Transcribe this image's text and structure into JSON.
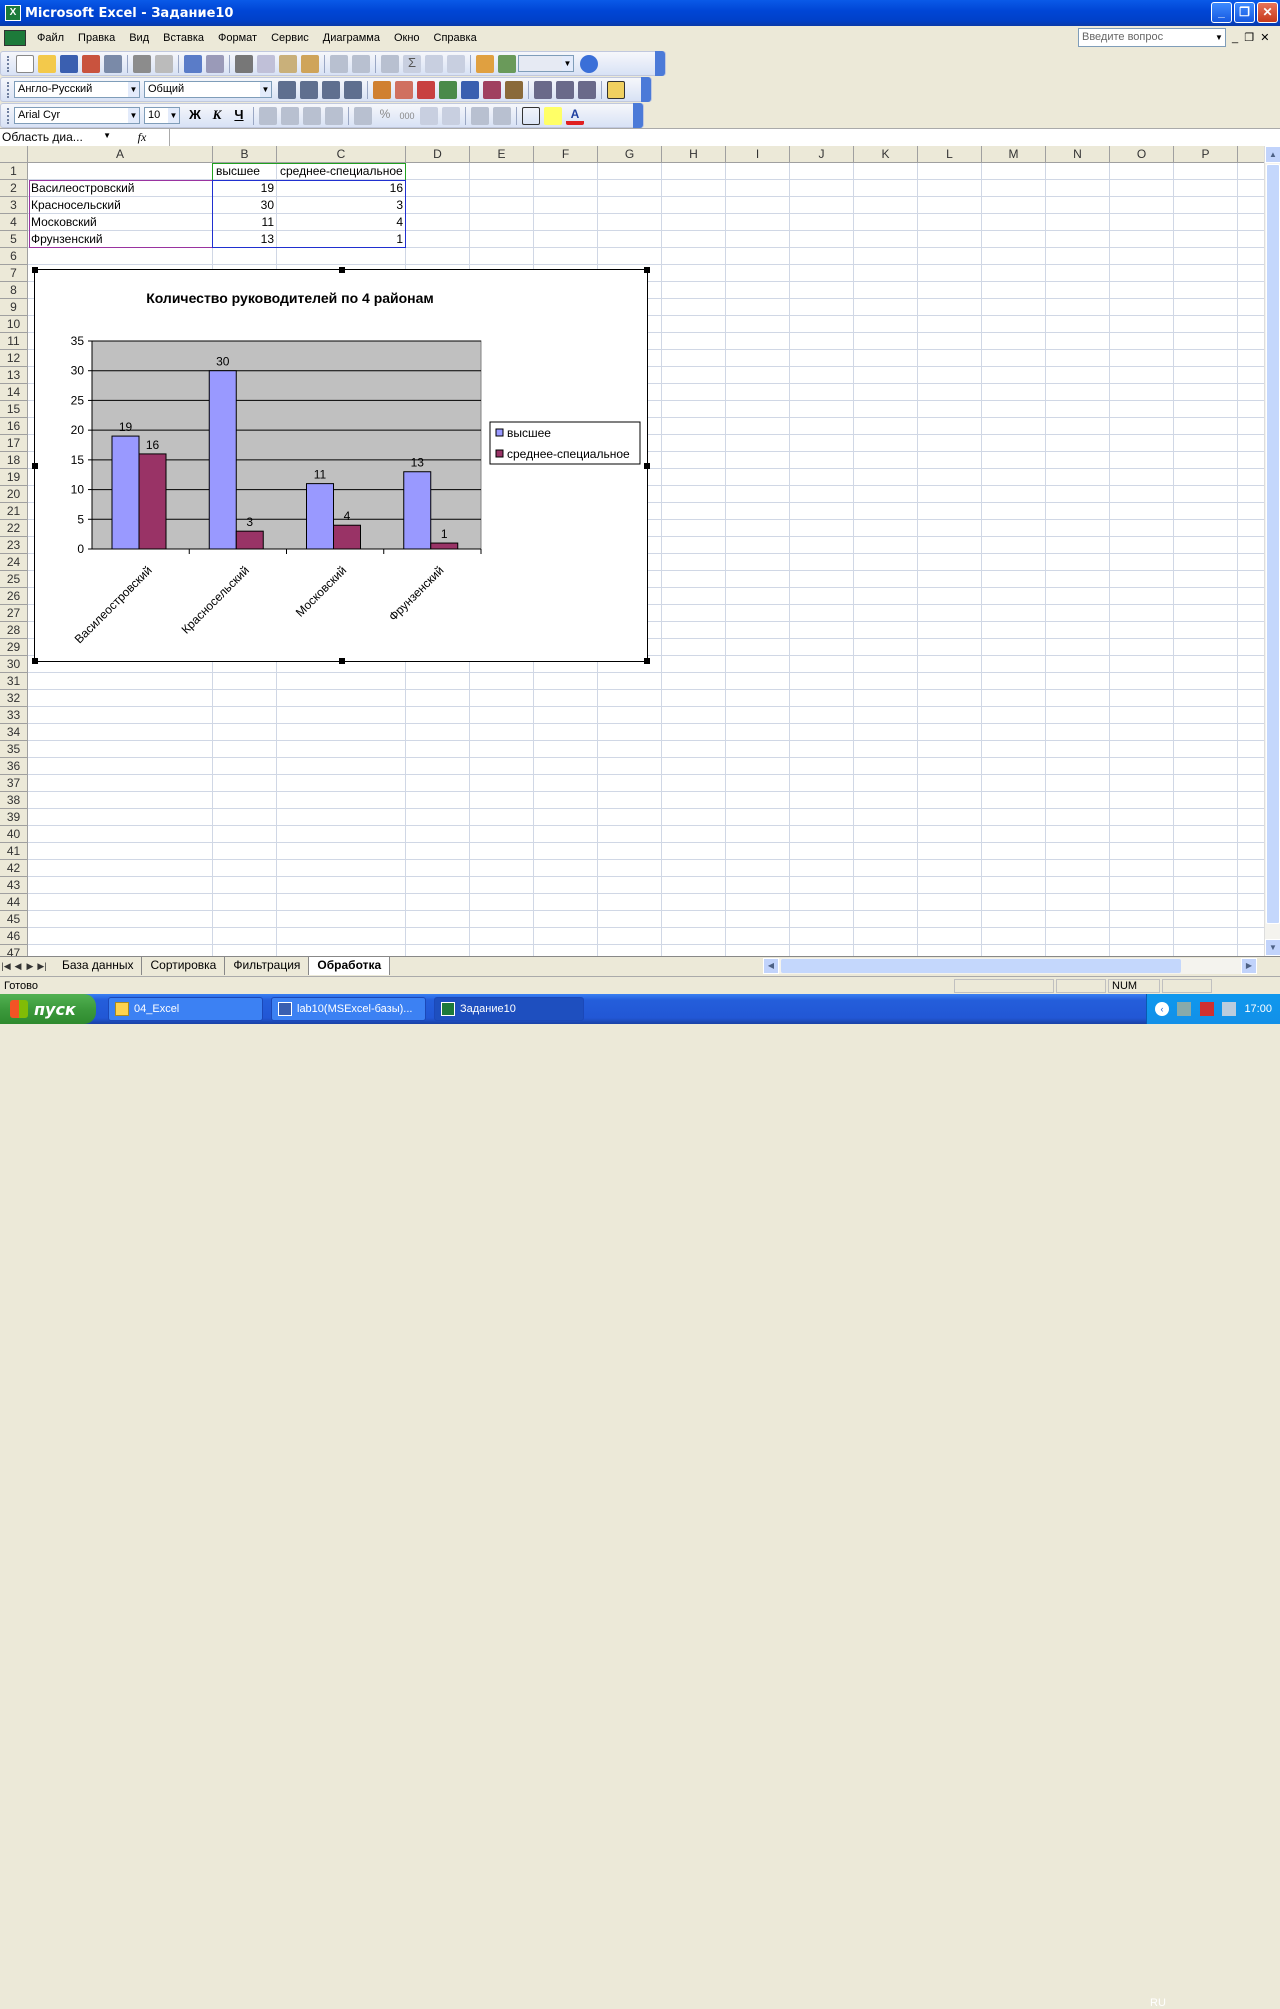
{
  "window": {
    "title": "Microsoft Excel - Задание10",
    "min": "_",
    "restore": "❐",
    "close": "✕"
  },
  "menu": {
    "items": [
      "Файл",
      "Правка",
      "Вид",
      "Вставка",
      "Формат",
      "Сервис",
      "Диаграмма",
      "Окно",
      "Справка"
    ],
    "ask_placeholder": "Введите вопрос"
  },
  "toolbar": {
    "dictionary_value": "Англо-Русский",
    "format_value": "Общий",
    "font_value": "Arial Cyr",
    "size_value": "10",
    "bold": "Ж",
    "italic": "К",
    "underline": "Ч",
    "percent": "%",
    "thousands": "000"
  },
  "formula_bar": {
    "name_box": "Область диа...",
    "fx": "fx"
  },
  "columns": [
    "A",
    "B",
    "C",
    "D",
    "E",
    "F",
    "G",
    "H",
    "I",
    "J",
    "K",
    "L",
    "M",
    "N",
    "O",
    "P"
  ],
  "rows": [
    "1",
    "2",
    "3",
    "4",
    "5",
    "6",
    "7",
    "8",
    "9",
    "10",
    "11",
    "12",
    "13",
    "14",
    "15",
    "16",
    "17",
    "18",
    "19",
    "20",
    "21",
    "22",
    "23",
    "24",
    "25",
    "26",
    "27",
    "28",
    "29",
    "30",
    "31",
    "32",
    "33",
    "34",
    "35",
    "36",
    "37",
    "38",
    "39",
    "40",
    "41",
    "42",
    "43",
    "44",
    "45",
    "46",
    "47"
  ],
  "cells": {
    "B1": "высшее",
    "C1": "среднее-специальное",
    "A2": "Василеостровский",
    "B2": "19",
    "C2": "16",
    "A3": "Красносельский",
    "B3": "30",
    "C3": "3",
    "A4": "Московский",
    "B4": "11",
    "C4": "4",
    "A5": "Фрунзенский",
    "B5": "13",
    "C5": "1"
  },
  "chart_data": {
    "type": "bar",
    "title": "Количество руководителей по 4 районам",
    "categories": [
      "Василеостровский",
      "Красносельский",
      "Московский",
      "Фрунзенский"
    ],
    "series": [
      {
        "name": "высшее",
        "values": [
          19,
          30,
          11,
          13
        ],
        "color": "#9999ff"
      },
      {
        "name": "среднее-специальное",
        "values": [
          16,
          3,
          4,
          1
        ],
        "color": "#993366"
      }
    ],
    "ylim": [
      0,
      35
    ],
    "yticks": [
      0,
      5,
      10,
      15,
      20,
      25,
      30,
      35
    ],
    "grid": true,
    "plot_background": "#c0c0c0",
    "legend_position": "right",
    "data_labels": true
  },
  "sheets": {
    "tabs": [
      "База данных",
      "Сортировка",
      "Фильтрация",
      "Обработка"
    ],
    "active": "Обработка"
  },
  "status": {
    "text": "Готово",
    "num": "NUM"
  },
  "taskbar": {
    "start": "пуск",
    "tasks": [
      "04_Excel",
      "lab10(MSExcel-базы)...",
      "Задание10"
    ],
    "lang": "RU",
    "clock": "17:00"
  }
}
